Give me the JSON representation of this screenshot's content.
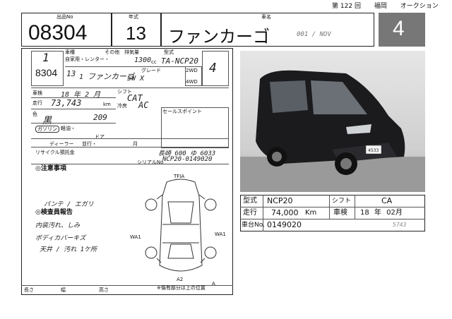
{
  "header": {
    "lot_label": "出品No",
    "year_label": "年式",
    "model_label": "車名",
    "round_prefix": "第",
    "round_number": "122",
    "round_suffix": "回",
    "venue": "福岡",
    "event": "オークション"
  },
  "lot": {
    "number": "08304",
    "year": "13",
    "model_name": "ファンカーゴ",
    "handwritten_code": "001 / NOV",
    "grade_score": "4"
  },
  "sheet": {
    "lot_short": "8304",
    "year_hand": "13",
    "month_hand": "1",
    "model_hand": "ファンカーゴ",
    "grade_hand": "5W  X",
    "kind_labels": [
      "車",
      "種",
      "自家用・レンター・",
      "その他"
    ],
    "size_label": "排気量",
    "displacement": "1300",
    "cc": "cc",
    "type_label": "型式",
    "model_code_hand": "TA-NCP20",
    "grade_label": "グレード",
    "drive_label": "2WD",
    "drive_label2": "4WD",
    "seats_hand": "4",
    "inspection_label": "車検",
    "inspection_hand": "18 年  2 月",
    "mileage_label": "走行",
    "mileage_hand": "73,743",
    "mileage_unit": "km",
    "color_label": "色",
    "color_hand": "黒",
    "color_code_hand": "209",
    "fuel_label": "ガソリン",
    "fuel_options": "軽油・",
    "doors_label": "ドア",
    "shift_label": "シフト",
    "shift_hand": "CAT",
    "aircon_label": "冷房",
    "aircon_hand": "AC",
    "recycle_label": "リサイクル預託金",
    "dealer_label": "ディーラー",
    "import_label": "並行・",
    "expiry_label": "月",
    "sales_point_label": "セールスポイント",
    "serial_label": "シリアルNo",
    "serial_hand": "NCP20-0149020",
    "note_hand": "長崎 600 ゆ 6033",
    "caution_label": "注意事項",
    "report_label": "検査員報告",
    "report_lines": [
      "パンテ / エガリ",
      "内装汚れ、しみ",
      "ボディカバーキズ",
      "天井 / 汚れ 1ケ所"
    ],
    "length_label": "長さ",
    "width_label": "幅",
    "height_label": "高さ",
    "diagram_note": "※傷有部分は上の位置",
    "diagram_marks": [
      "TFIA",
      "WA1",
      "WA1",
      "A2",
      "A2",
      "A"
    ]
  },
  "summary": {
    "type_label": "型式",
    "type_value": "NCP20",
    "shift_label": "シフト",
    "shift_value": "CA",
    "mileage_label": "走行",
    "mileage_value": "74,000",
    "mileage_unit": "Km",
    "inspection_label": "車検",
    "inspection_year": "18",
    "inspection_year_unit": "年",
    "inspection_month": "02",
    "inspection_month_unit": "月",
    "chassis_label": "車台No.",
    "chassis_value": "0149020",
    "chassis_hand": "5743"
  },
  "photo": {
    "plate_text": "4533",
    "car_color": "#1b1b1e"
  }
}
